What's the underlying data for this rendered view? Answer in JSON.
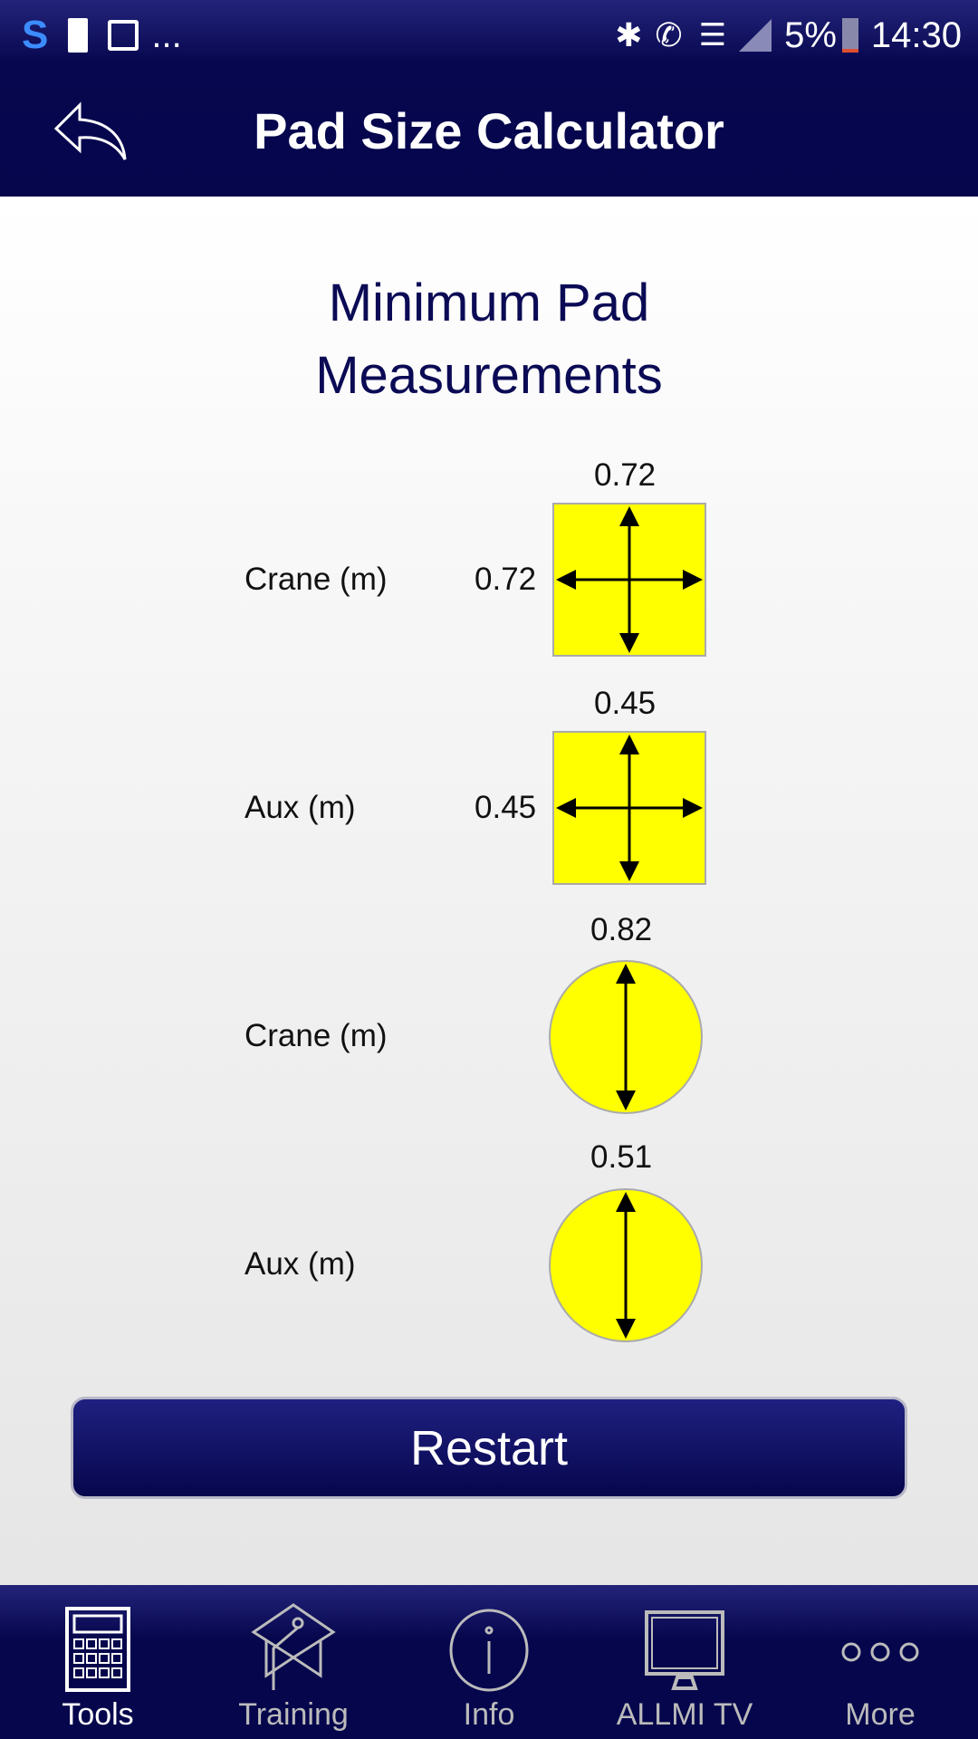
{
  "status_bar": {
    "time": "14:30",
    "battery": "5%",
    "overflow": "..."
  },
  "header": {
    "title": "Pad Size Calculator",
    "back_icon": "back-arrow-icon"
  },
  "main": {
    "heading_line1": "Minimum Pad",
    "heading_line2": "Measurements",
    "rows": [
      {
        "label": "Crane (m)",
        "shape": "square",
        "top": "0.72",
        "side": "0.72"
      },
      {
        "label": "Aux (m)",
        "shape": "square",
        "top": "0.45",
        "side": "0.45"
      },
      {
        "label": "Crane (m)",
        "shape": "circle",
        "top": "0.82"
      },
      {
        "label": "Aux (m)",
        "shape": "circle",
        "top": "0.51"
      }
    ],
    "restart_label": "Restart",
    "pad_color": "#ffff00"
  },
  "nav": {
    "items": [
      {
        "label": "Tools",
        "icon": "calculator-icon",
        "active": true
      },
      {
        "label": "Training",
        "icon": "graduation-cap-icon"
      },
      {
        "label": "Info",
        "icon": "info-icon"
      },
      {
        "label": "ALLMI TV",
        "icon": "monitor-icon"
      },
      {
        "label": "More",
        "icon": "more-dots-icon"
      }
    ]
  }
}
